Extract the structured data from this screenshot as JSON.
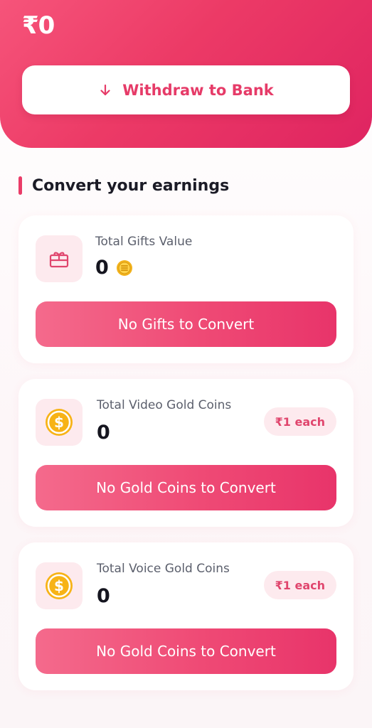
{
  "header": {
    "balance": "₹0",
    "withdraw_label": "Withdraw to Bank"
  },
  "section": {
    "title": "Convert your earnings"
  },
  "cards": [
    {
      "label": "Total Gifts Value",
      "value": "0",
      "button_label": "No Gifts to Convert",
      "icon": "gift-icon"
    },
    {
      "label": "Total Video Gold Coins",
      "value": "0",
      "badge": "₹1 each",
      "button_label": "No Gold Coins to Convert",
      "icon": "dollar-coin-icon"
    },
    {
      "label": "Total Voice Gold Coins",
      "value": "0",
      "badge": "₹1 each",
      "button_label": "No Gold Coins to Convert",
      "icon": "dollar-coin-icon"
    }
  ],
  "colors": {
    "accent": "#ec3a66",
    "icon_bg": "#fdeaee",
    "coin": "#f7b316"
  }
}
